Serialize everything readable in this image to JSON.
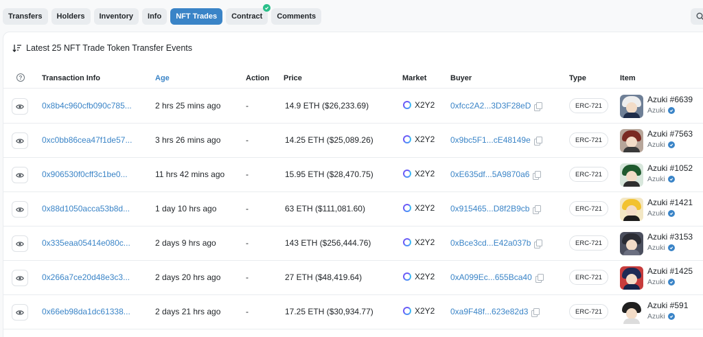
{
  "tabs": [
    {
      "label": "Transfers"
    },
    {
      "label": "Holders"
    },
    {
      "label": "Inventory"
    },
    {
      "label": "Info"
    },
    {
      "label": "NFT Trades"
    },
    {
      "label": "Contract"
    },
    {
      "label": "Comments"
    }
  ],
  "active_tab": "NFT Trades",
  "card": {
    "title": "Latest 25 NFT Trade Token Transfer Events"
  },
  "table": {
    "headers": {
      "txn": "Transaction Info",
      "age": "Age",
      "action": "Action",
      "price": "Price",
      "market": "Market",
      "buyer": "Buyer",
      "type": "Type",
      "item": "Item"
    },
    "rows": [
      {
        "txn": "0x8b4c960cfb090c785...",
        "age": "2 hrs 25 mins ago",
        "action": "-",
        "price": "14.9 ETH ($26,233.69)",
        "market": "X2Y2",
        "buyer": "0xfcc2A2...3D3F28eD",
        "type": "ERC-721",
        "item": "Azuki #6639",
        "collection": "Azuki"
      },
      {
        "txn": "0xc0bb86cea47f1de57...",
        "age": "3 hrs 26 mins ago",
        "action": "-",
        "price": "14.25 ETH ($25,089.26)",
        "market": "X2Y2",
        "buyer": "0x9bc5F1...cE48149e",
        "type": "ERC-721",
        "item": "Azuki #7563",
        "collection": "Azuki"
      },
      {
        "txn": "0x906530f0cff3c1be0...",
        "age": "11 hrs 42 mins ago",
        "action": "-",
        "price": "15.95 ETH ($28,470.75)",
        "market": "X2Y2",
        "buyer": "0xE635df...5A9870a6",
        "type": "ERC-721",
        "item": "Azuki #1052",
        "collection": "Azuki"
      },
      {
        "txn": "0x88d1050acca53b8d...",
        "age": "1 day 10 hrs ago",
        "action": "-",
        "price": "63 ETH ($111,081.60)",
        "market": "X2Y2",
        "buyer": "0x915465...D8f2B9cb",
        "type": "ERC-721",
        "item": "Azuki #1421",
        "collection": "Azuki"
      },
      {
        "txn": "0x335eaa05414e080c...",
        "age": "2 days 9 hrs ago",
        "action": "-",
        "price": "143 ETH ($256,444.76)",
        "market": "X2Y2",
        "buyer": "0xBce3cd...E42a037b",
        "type": "ERC-721",
        "item": "Azuki #3153",
        "collection": "Azuki"
      },
      {
        "txn": "0x266a7ce20d48e3c3...",
        "age": "2 days 20 hrs ago",
        "action": "-",
        "price": "27 ETH ($48,419.64)",
        "market": "X2Y2",
        "buyer": "0xA099Ec...655Bca40",
        "type": "ERC-721",
        "item": "Azuki #1425",
        "collection": "Azuki"
      },
      {
        "txn": "0x66eb98da1dc61338...",
        "age": "2 days 21 hrs ago",
        "action": "-",
        "price": "17.25 ETH ($30,934.77)",
        "market": "X2Y2",
        "buyer": "0xa9F48f...623e82d3",
        "type": "ERC-721",
        "item": "Azuki #591",
        "collection": "Azuki"
      }
    ]
  },
  "colors": {
    "accent": "#3a84c7",
    "verified": "#2bbf8a"
  }
}
